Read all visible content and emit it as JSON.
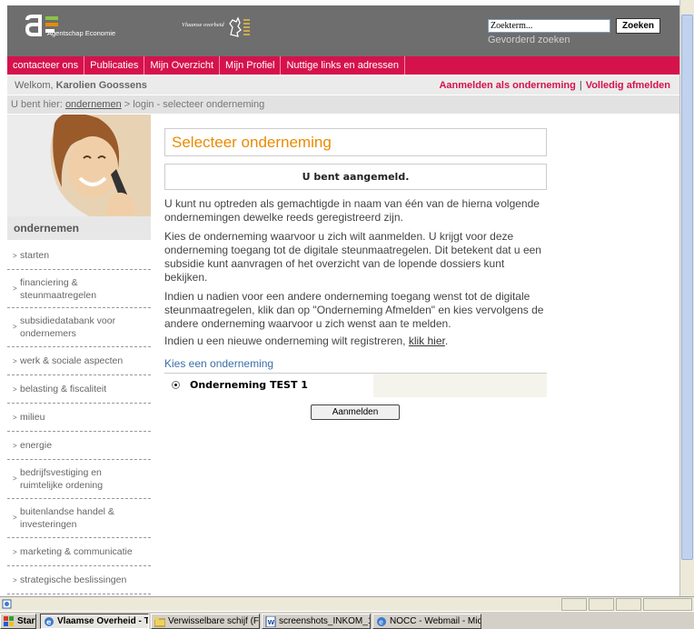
{
  "header": {
    "logo_text": "Agentschap Economie",
    "government_label": "Vlaamse overheid",
    "search_placeholder": "Zoekterm...",
    "search_button": "Zoeken",
    "advanced_search": "Gevorderd zoeken"
  },
  "nav": [
    "contacteer ons",
    "Publicaties",
    "Mijn Overzicht",
    "Mijn Profiel",
    "Nuttige links en adressen"
  ],
  "welcome": {
    "prefix": "Welkom,",
    "user": "Karolien Goossens",
    "login_company": "Aanmelden als onderneming",
    "separator": "|",
    "logout": "Volledig afmelden"
  },
  "breadcrumb": {
    "prefix": "U bent hier:",
    "link": "ondernemen",
    "sep": ">",
    "current": "login - selecteer onderneming"
  },
  "sidebar": {
    "title": "ondernemen",
    "items": [
      "starten",
      "financiering & steunmaatregelen",
      "subsidiedatabank voor ondernemers",
      "werk & sociale aspecten",
      "belasting & fiscaliteit",
      "milieu",
      "energie",
      "bedrijfsvestiging en ruimtelijke ordening",
      "buitenlandse handel & investeringen",
      "marketing & communicatie",
      "strategische beslissingen"
    ]
  },
  "content": {
    "title": "Selecteer onderneming",
    "notice": "U bent aangemeld.",
    "p1": "U kunt nu optreden als gemachtigde in naam van één van de hierna volgende ondernemingen dewelke reeds geregistreerd zijn.",
    "p2": "Kies de onderneming waarvoor u zich wilt aanmelden. U krijgt voor deze onderneming toegang tot de digitale steunmaatregelen. Dit betekent dat u een subsidie kunt aanvragen of het overzicht van de lopende dossiers kunt bekijken.",
    "p3": "Indien u nadien voor een andere onderneming toegang wenst tot de digitale steunmaatregelen, klik dan op \"Onderneming Afmelden\" en kies vervolgens de andere onderneming waarvoor u zich wenst aan te melden.",
    "p4_prefix": "Indien u een nieuwe onderneming wilt registreren,",
    "p4_link": "klik hier",
    "p4_suffix": ".",
    "choose_label": "Kies een onderneming",
    "company": "Onderneming TEST 1",
    "submit": "Aanmelden"
  },
  "taskbar": {
    "start": "Start",
    "buttons": [
      "Vlaamse Overheid - T...",
      "Verwisselbare schijf (F:)",
      "screenshots_INKOM_11-...",
      "NOCC - Webmail - Micros..."
    ]
  },
  "colors": {
    "brand_red": "#d6124c",
    "header_grey": "#6e6e6e",
    "title_orange": "#e98b00",
    "link_blue": "#3a6fa8"
  }
}
